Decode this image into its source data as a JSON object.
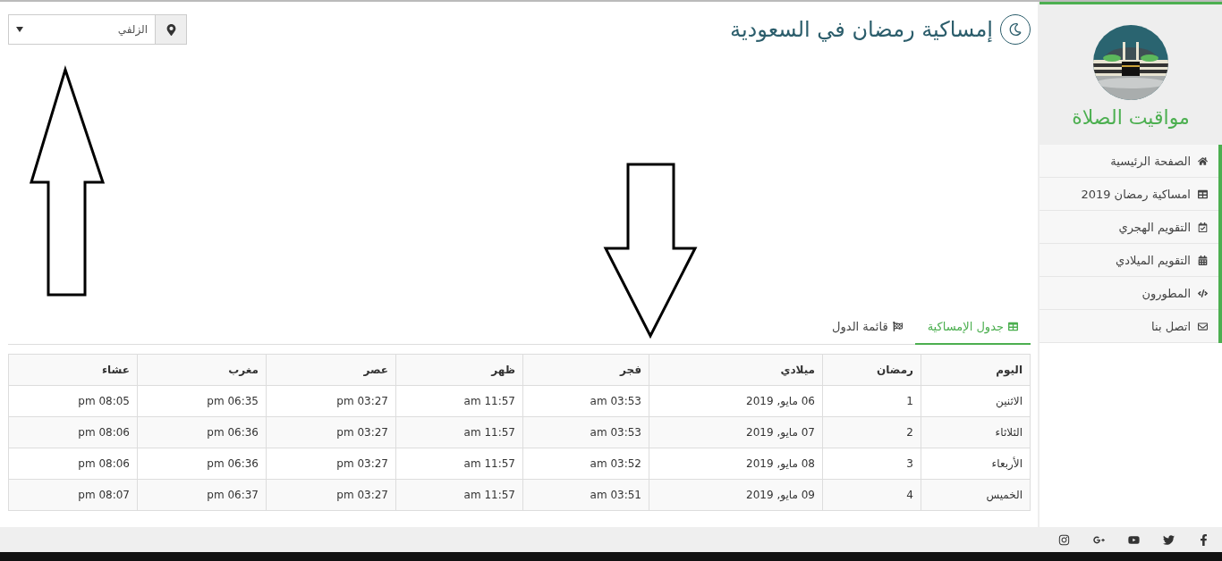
{
  "header": {
    "title": "إمساكية رمضان في السعودية"
  },
  "city_select": {
    "value": "الزلفي"
  },
  "sidebar": {
    "brand": "مواقيت الصلاة",
    "items": [
      {
        "label": "الصفحة الرئيسية",
        "selected": false
      },
      {
        "label": "امساكية رمضان 2019",
        "selected": false
      },
      {
        "label": "التقويم الهجري",
        "selected": false
      },
      {
        "label": "التقويم الميلادي",
        "selected": false
      },
      {
        "label": "المطورون",
        "selected": false
      },
      {
        "label": "اتصل بنا",
        "selected": false
      }
    ]
  },
  "tabs": [
    {
      "label": "جدول الإمساكية",
      "selected": true
    },
    {
      "label": "قائمة الدول",
      "selected": false
    }
  ],
  "table": {
    "columns": [
      "اليوم",
      "رمضان",
      "ميلادي",
      "فجر",
      "ظهر",
      "عصر",
      "مغرب",
      "عشاء"
    ],
    "rows": [
      [
        "الاثنين",
        "1",
        "06 مايو, 2019",
        "am 03:53",
        "am 11:57",
        "pm 03:27",
        "pm 06:35",
        "pm 08:05"
      ],
      [
        "الثلاثاء",
        "2",
        "07 مايو, 2019",
        "am 03:53",
        "am 11:57",
        "pm 03:27",
        "pm 06:36",
        "pm 08:06"
      ],
      [
        "الأربعاء",
        "3",
        "08 مايو, 2019",
        "am 03:52",
        "am 11:57",
        "pm 03:27",
        "pm 06:36",
        "pm 08:06"
      ],
      [
        "الخميس",
        "4",
        "09 مايو, 2019",
        "am 03:51",
        "am 11:57",
        "pm 03:27",
        "pm 06:37",
        "pm 08:07"
      ]
    ]
  }
}
